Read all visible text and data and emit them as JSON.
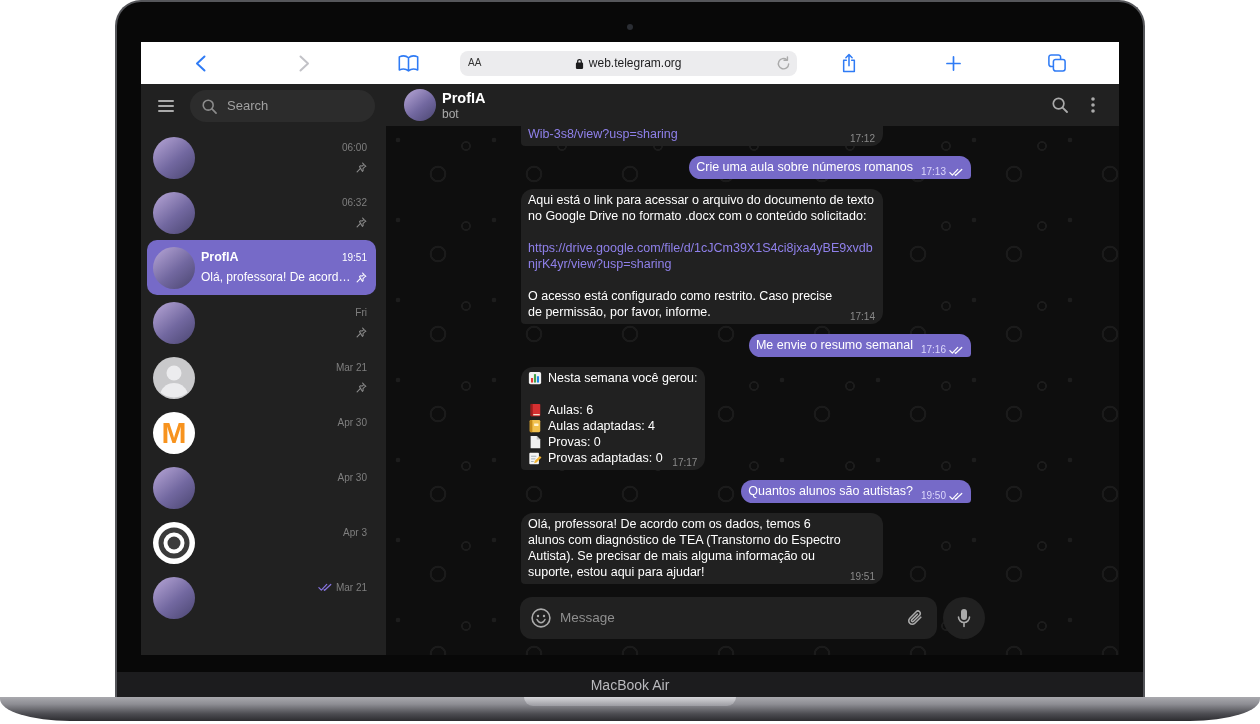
{
  "device": {
    "label": "MacBook Air"
  },
  "browser": {
    "nav": [
      {
        "kind": "back",
        "disabled": false
      },
      {
        "kind": "forward",
        "disabled": true
      }
    ],
    "reader": "AA",
    "url": "web.telegram.org"
  },
  "sidebar": {
    "search": {
      "placeholder": "Search"
    },
    "chats": [
      {
        "kind": "photo",
        "time": "06:00",
        "pinned": true,
        "read": false,
        "selected": false
      },
      {
        "kind": "photo",
        "time": "06:32",
        "pinned": true,
        "read": false,
        "selected": false
      },
      {
        "kind": "photo",
        "name": "ProfIA",
        "preview": "Olá, professora! De acord…",
        "time": "19:51",
        "pinned": true,
        "read": false,
        "selected": true
      },
      {
        "kind": "photo",
        "time": "Fri",
        "pinned": true,
        "read": false,
        "selected": false
      },
      {
        "kind": "unknown",
        "time": "Mar 21",
        "pinned": true,
        "read": false,
        "selected": false
      },
      {
        "kind": "letter",
        "avatar_text": "M",
        "time": "Apr 30",
        "pinned": false,
        "read": false,
        "selected": false
      },
      {
        "kind": "photo",
        "time": "Apr 30",
        "pinned": false,
        "read": false,
        "selected": false
      },
      {
        "kind": "ring",
        "time": "Apr 3",
        "pinned": false,
        "read": false,
        "selected": false
      },
      {
        "kind": "photo",
        "time": "Mar 21",
        "pinned": false,
        "read": true,
        "selected": false
      }
    ]
  },
  "chat": {
    "title": "ProfIA",
    "subtitle": "bot",
    "messages": [
      {
        "kind": "in",
        "clipped": true,
        "blocks": [
          {
            "kind": "link",
            "text": "Wib-3s8/view?usp=sharing"
          }
        ],
        "time": "17:12"
      },
      {
        "kind": "out",
        "clipped": false,
        "blocks": [
          {
            "kind": "text",
            "text": "Crie uma aula sobre números romanos"
          }
        ],
        "time": "17:13",
        "read": true
      },
      {
        "kind": "in",
        "clipped": false,
        "blocks": [
          {
            "kind": "text",
            "text": "Aqui está o link para acessar o arquivo do documento de texto no Google Drive no formato .docx com o conteúdo solicitado:"
          },
          {
            "kind": "link",
            "text": "https://drive.google.com/file/d/1cJCm39X1S4ci8jxa4yBE9xvdbnjrK4yr/view?usp=sharing"
          },
          {
            "kind": "text",
            "text": "O acesso está configurado como restrito. Caso precise de permissão, por favor, informe."
          }
        ],
        "time": "17:14"
      },
      {
        "kind": "out",
        "clipped": false,
        "blocks": [
          {
            "kind": "text",
            "text": "Me envie o resumo semanal"
          }
        ],
        "time": "17:16",
        "read": true
      },
      {
        "kind": "in",
        "clipped": false,
        "blocks": [
          {
            "kind": "items",
            "items": [
              {
                "kind": "chart",
                "text": "Nesta semana você gerou:"
              }
            ]
          },
          {
            "kind": "items",
            "items": [
              {
                "kind": "book",
                "text": "Aulas: 6"
              },
              {
                "kind": "ledger",
                "text": "Aulas adaptadas: 4"
              },
              {
                "kind": "page",
                "text": "Provas: 0"
              },
              {
                "kind": "memo",
                "text": "Provas adaptadas: 0"
              }
            ]
          }
        ],
        "time": "17:17"
      },
      {
        "kind": "out",
        "clipped": false,
        "blocks": [
          {
            "kind": "text",
            "text": "Quantos alunos são autistas?"
          }
        ],
        "time": "19:50",
        "read": true
      },
      {
        "kind": "in",
        "clipped": false,
        "blocks": [
          {
            "kind": "text",
            "text": "Olá, professora! De acordo com os dados, temos 6 alunos com diagnóstico de TEA (Transtorno do Espectro Autista). Se precisar de mais alguma informação ou suporte, estou aqui para ajudar!"
          }
        ],
        "time": "19:51"
      }
    ],
    "composer": {
      "placeholder": "Message"
    }
  }
}
